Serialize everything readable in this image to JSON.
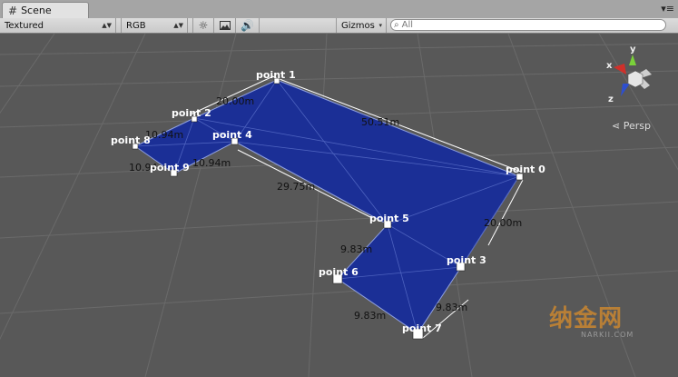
{
  "window": {
    "tab_icon": "grid-icon",
    "tab_title": "Scene",
    "menu_glyph": "▾≡"
  },
  "toolbar": {
    "draw_mode": "Textured",
    "render_mode": "RGB",
    "gizmos_label": "Gizmos",
    "search_placeholder": "All",
    "icons": [
      "sun-icon",
      "image-icon",
      "speaker-icon"
    ]
  },
  "scene": {
    "points": [
      {
        "id": "point-0",
        "label": "point 0"
      },
      {
        "id": "point-1",
        "label": "point 1"
      },
      {
        "id": "point-2",
        "label": "point 2"
      },
      {
        "id": "point-3",
        "label": "point 3"
      },
      {
        "id": "point-4",
        "label": "point 4"
      },
      {
        "id": "point-5",
        "label": "point 5"
      },
      {
        "id": "point-6",
        "label": "point 6"
      },
      {
        "id": "point-7",
        "label": "point 7"
      },
      {
        "id": "point-8",
        "label": "point 8"
      },
      {
        "id": "point-9",
        "label": "point 9"
      }
    ],
    "dimensions": [
      "20.00m",
      "50.51m",
      "10.94m",
      "10.94m",
      "10.94m",
      "29.75m",
      "20.00m",
      "9.83m",
      "9.83m",
      "9.83m"
    ],
    "mesh_color": "#1b2f96",
    "gizmo_axes": {
      "x": "x",
      "y": "y",
      "z": "z"
    },
    "projection_label": "Persp"
  },
  "watermark": {
    "text": "纳金网",
    "sub": "NARKII.COM"
  }
}
